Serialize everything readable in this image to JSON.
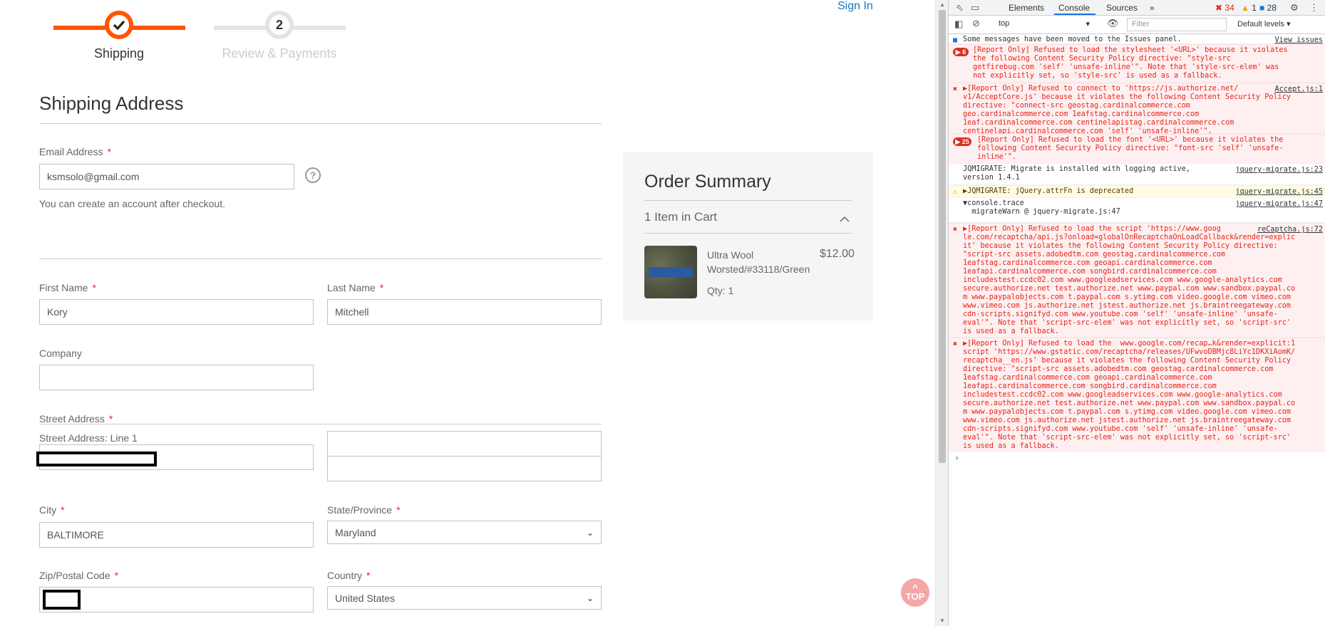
{
  "checkout": {
    "sign_in": "Sign In",
    "steps": [
      {
        "num": "✓",
        "label": "Shipping"
      },
      {
        "num": "2",
        "label": "Review & Payments"
      }
    ],
    "section_title": "Shipping Address",
    "email_label": "Email Address",
    "email_value": "ksmsolo@gmail.com",
    "email_help": "?",
    "account_note": "You can create an account after checkout.",
    "first_name_label": "First Name",
    "first_name_value": "Kory",
    "last_name_label": "Last Name",
    "last_name_value": "Mitchell",
    "company_label": "Company",
    "street_label": "Street Address",
    "street_line1_label": "Street Address: Line 1",
    "city_label": "City",
    "city_value": "BALTIMORE",
    "state_label": "State/Province",
    "state_value": "Maryland",
    "zip_label": "Zip/Postal Code",
    "country_label": "Country",
    "country_value": "United States",
    "required_mark": "*"
  },
  "summary": {
    "title": "Order Summary",
    "count": "1 Item in Cart",
    "item_name": "Ultra Wool Worsted/#33118/Green",
    "item_price": "$12.00",
    "item_qty": "Qty: 1"
  },
  "top_button": {
    "arrow": "^",
    "label": "TOP"
  },
  "devtools": {
    "tabs": [
      "Elements",
      "Console",
      "Sources"
    ],
    "more": "»",
    "errors": "34",
    "warnings": "1",
    "info": "28",
    "context": "top",
    "filter_placeholder": "Filter",
    "levels": "Default levels ▾",
    "messages": [
      {
        "type": "info",
        "text": "Some messages have been moved to the Issues panel.",
        "src": "View issues"
      },
      {
        "type": "err",
        "badge": "6",
        "text": "[Report Only] Refused to load the stylesheet '<URL>' because it violates\nthe following Content Security Policy directive: \"style-src\ngetfirebug.com 'self' 'unsafe-inline'\". Note that 'style-src-elem' was\nnot explicitly set, so 'style-src' is used as a fallback."
      },
      {
        "type": "err",
        "text": "▶[Report Only] Refused to connect to 'https://js.authorize.net/\nv1/AcceptCore.js' because it violates the following Content Security Policy\ndirective: \"connect-src geostag.cardinalcommerce.com\ngeo.cardinalcommerce.com 1eafstag.cardinalcommerce.com\n1eaf.cardinalcommerce.com centinelapistag.cardinalcommerce.com\ncentinelapi.cardinalcommerce.com 'self' 'unsafe-inline'\".",
        "src": "Accept.js:1"
      },
      {
        "type": "err",
        "badge": "25",
        "text": "[Report Only] Refused to load the font '<URL>' because it violates the\nfollowing Content Security Policy directive: \"font-src 'self' 'unsafe-\ninline'\"."
      },
      {
        "type": "info",
        "text": "JQMIGRATE: Migrate is installed with logging active,\nversion 1.4.1",
        "src": "jquery-migrate.js:23"
      },
      {
        "type": "warn",
        "text": "▶JQMIGRATE: jQuery.attrFn is deprecated",
        "src": "jquery-migrate.js:45"
      },
      {
        "type": "info",
        "text": "▼console.trace\n  migrateWarn @ jquery-migrate.js:47",
        "src": "jquery-migrate.js:47"
      },
      {
        "type": "err",
        "text": "▶[Report Only] Refused to load the script 'https://www.goog\nle.com/recaptcha/api.js?onload=globalOnRecaptchaOnLoadCallback&render=explic\nit' because it violates the following Content Security Policy directive:\n\"script-src assets.adobedtm.com geostag.cardinalcommerce.com\n1eafstag.cardinalcommerce.com geoapi.cardinalcommerce.com\n1eafapi.cardinalcommerce.com songbird.cardinalcommerce.com\nincludestest.ccdc02.com www.googleadservices.com www.google-analytics.com\nsecure.authorize.net test.authorize.net www.paypal.com www.sandbox.paypal.co\nm www.paypalobjects.com t.paypal.com s.ytimg.com video.google.com vimeo.com\nwww.vimeo.com js.authorize.net jstest.authorize.net js.braintreegateway.com\ncdn-scripts.signifyd.com www.youtube.com 'self' 'unsafe-inline' 'unsafe-\neval'\". Note that 'script-src-elem' was not explicitly set, so 'script-src'\nis used as a fallback.",
        "src": "reCaptcha.js:72"
      },
      {
        "type": "err",
        "text": "▶[Report Only] Refused to load the  www.google.com/recap…k&render=explicit:1\nscript 'https://www.gstatic.com/recaptcha/releases/UFwvoDBMjc8LiYc1DKXiAomK/\nrecaptcha__en.js' because it violates the following Content Security Policy\ndirective: \"script-src assets.adobedtm.com geostag.cardinalcommerce.com\n1eafstag.cardinalcommerce.com geoapi.cardinalcommerce.com\n1eafapi.cardinalcommerce.com songbird.cardinalcommerce.com\nincludestest.ccdc02.com www.googleadservices.com www.google-analytics.com\nsecure.authorize.net test.authorize.net www.paypal.com www.sandbox.paypal.co\nm www.paypalobjects.com t.paypal.com s.ytimg.com video.google.com vimeo.com\nwww.vimeo.com js.authorize.net jstest.authorize.net js.braintreegateway.com\ncdn-scripts.signifyd.com www.youtube.com 'self' 'unsafe-inline' 'unsafe-\neval'\". Note that 'script-src-elem' was not explicitly set, so 'script-src'\nis used as a fallback."
      }
    ],
    "prompt": "›"
  }
}
